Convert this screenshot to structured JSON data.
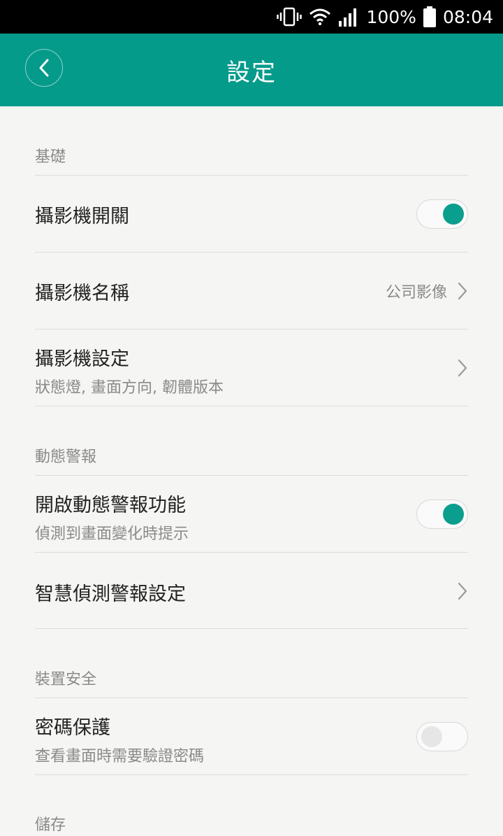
{
  "status_bar": {
    "battery": "100%",
    "time": "08:04",
    "icons": [
      "vibrate-icon",
      "wifi-icon",
      "signal-icon",
      "battery-icon"
    ]
  },
  "header": {
    "title": "設定",
    "back_icon": "chevron-left-icon"
  },
  "sections": {
    "basic": {
      "title": "基礎",
      "camera_switch": {
        "label": "攝影機開關",
        "state": "on"
      },
      "camera_name": {
        "label": "攝影機名稱",
        "value": "公司影像"
      },
      "camera_settings": {
        "label": "攝影機設定",
        "subtitle": "狀態燈, 畫面方向, 韌體版本"
      }
    },
    "motion_alert": {
      "title": "動態警報",
      "enable": {
        "label": "開啟動態警報功能",
        "subtitle": "偵測到畫面變化時提示",
        "state": "on"
      },
      "smart": {
        "label": "智慧偵測警報設定"
      }
    },
    "security": {
      "title": "裝置安全",
      "password": {
        "label": "密碼保護",
        "subtitle": "查看畫面時需要驗證密碼",
        "state": "off"
      }
    },
    "storage": {
      "title": "儲存"
    }
  },
  "colors": {
    "accent": "#059b8b",
    "toggle_on": "#0a9e8e",
    "background": "#f5f5f3"
  }
}
